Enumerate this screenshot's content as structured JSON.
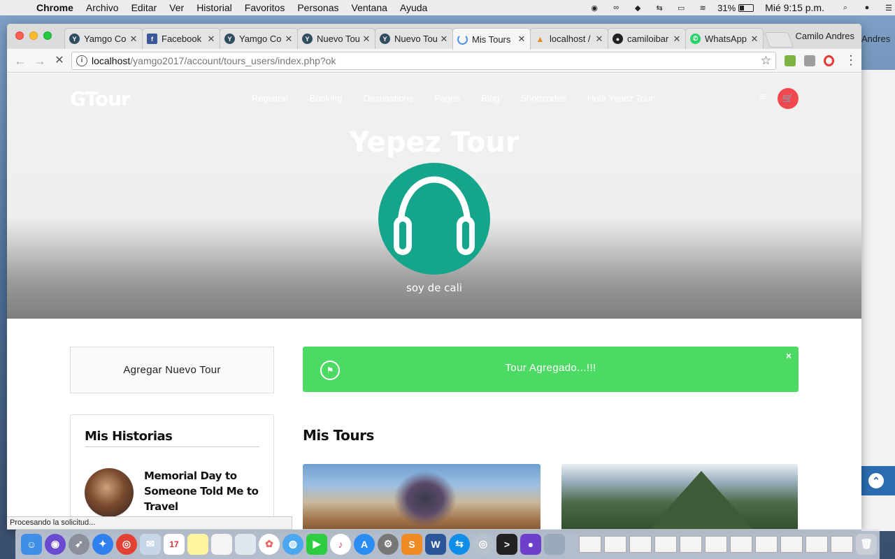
{
  "menubar": {
    "app": "Chrome",
    "items": [
      "Archivo",
      "Editar",
      "Ver",
      "Historial",
      "Favoritos",
      "Personas",
      "Ventana",
      "Ayuda"
    ],
    "battery": "31%",
    "clock": "Mié 9:15 p.m."
  },
  "browser": {
    "tabs": [
      {
        "label": "Yamgo Co",
        "icon": "yamgo-icon"
      },
      {
        "label": "Facebook",
        "icon": "facebook-icon"
      },
      {
        "label": "Yamgo Co",
        "icon": "yamgo-icon"
      },
      {
        "label": "Nuevo Tou",
        "icon": "yamgo-icon"
      },
      {
        "label": "Nuevo Tou",
        "icon": "yamgo-icon"
      },
      {
        "label": "Mis Tours",
        "icon": "loading-spinner-icon"
      },
      {
        "label": "localhost /",
        "icon": "phpmyadmin-icon"
      },
      {
        "label": "camiloibar",
        "icon": "github-icon"
      },
      {
        "label": "WhatsApp",
        "icon": "whatsapp-icon"
      }
    ],
    "profile": "Camilo Andres",
    "url_host": "localhost",
    "url_path": "/yamgo2017/account/tours_users/index.php?ok",
    "status": "Procesando la solicitud..."
  },
  "site": {
    "logo": "GTour",
    "nav": [
      "Registrar",
      "Booking",
      "Destinations",
      "Pages",
      "Blog",
      "Shortcodes",
      "Hola Yepez Tour"
    ],
    "hero_title": "Yepez Tour",
    "hero_subtitle": "soy de cali",
    "add_tour_label": "Agregar Nuevo Tour",
    "alert_message": "Tour Agregado...!!!",
    "alert_close": "×",
    "stories_heading": "Mis Historias",
    "story_title": "Memorial Day to Someone Told Me to Travel",
    "tours_heading": "Mis Tours"
  },
  "desktop": {
    "right_window_tab": "Andres"
  },
  "colors": {
    "accent_green": "#4cd964",
    "avatar_teal": "#14a58a",
    "cart_red": "#f0484e"
  }
}
